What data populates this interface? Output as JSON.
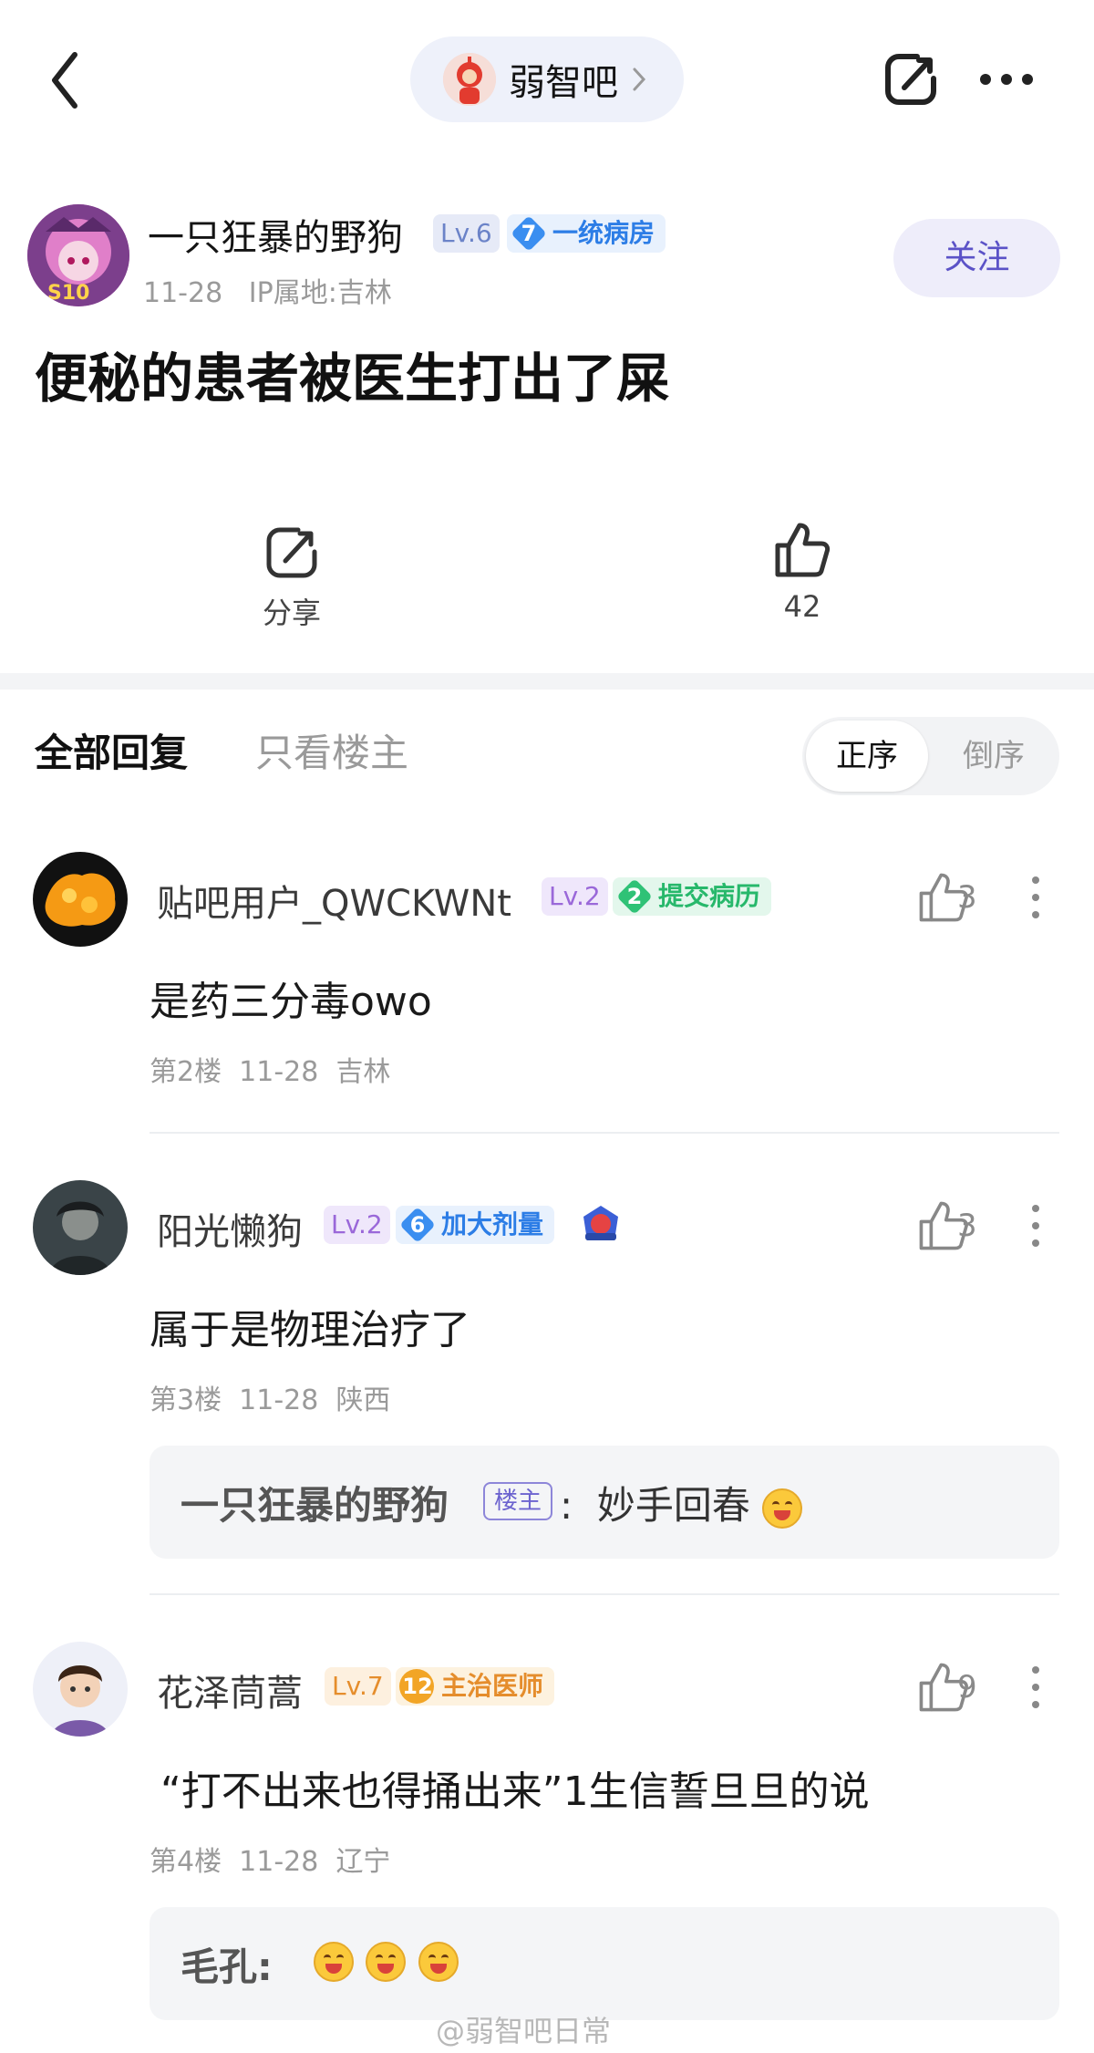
{
  "nav": {
    "forum_name": "弱智吧"
  },
  "post": {
    "author": {
      "name": "一只狂暴的野狗",
      "level": "Lv.6",
      "honor_num": "7",
      "honor_label": "一统病房",
      "date": "11-28",
      "ip": "IP属地:吉林",
      "follow_label": "关注"
    },
    "title": "便秘的患者被医生打出了屎",
    "actions": {
      "share_label": "分享",
      "like_count": "42"
    }
  },
  "tabs": {
    "all_label": "全部回复",
    "owner_only_label": "只看楼主",
    "sort_asc": "正序",
    "sort_desc": "倒序"
  },
  "comments": [
    {
      "user": "贴吧用户_QWCKWNt",
      "level": "Lv.2",
      "honor_num": "2",
      "honor_label": "提交病历",
      "likes": "3",
      "text": "是药三分毒owo",
      "floor": "第2楼",
      "date": "11-28",
      "location": "吉林"
    },
    {
      "user": "阳光懒狗",
      "level": "Lv.2",
      "honor_num": "6",
      "honor_label": "加大剂量",
      "likes": "3",
      "text": "属于是物理治疗了",
      "floor": "第3楼",
      "date": "11-28",
      "location": "陕西",
      "reply": {
        "name": "一只狂暴的野狗",
        "tag": "楼主",
        "text": "妙手回春"
      }
    },
    {
      "user": "花泽茼蒿",
      "level": "Lv.7",
      "honor_num": "12",
      "honor_label": "主治医师",
      "likes": "9",
      "text": "“打不出来也得捅出来”1生信誓旦旦的说",
      "floor": "第4楼",
      "date": "11-28",
      "location": "辽宁",
      "reply": {
        "name": "毛孔:"
      }
    }
  ],
  "watermark": "@弱智吧日常",
  "colors": {
    "accent": "#5b52c7",
    "honor_blue": "#2c7de6",
    "honor_green": "#27b86b",
    "honor_orange": "#e58d2c"
  }
}
